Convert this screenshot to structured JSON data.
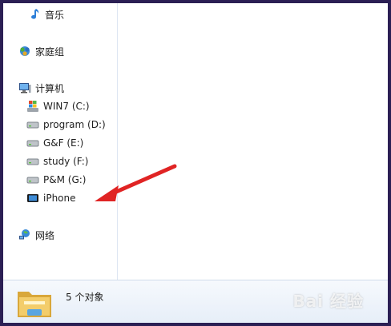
{
  "colors": {
    "frame": "#2b1f54",
    "arrow": "#e02424",
    "status_bg": "#e6eef8"
  },
  "nav": {
    "music": {
      "label": "音乐",
      "icon": "music-note-icon"
    },
    "homegroup": {
      "label": "家庭组",
      "icon": "homegroup-icon"
    },
    "computer": {
      "label": "计算机",
      "icon": "computer-icon"
    },
    "drives": [
      {
        "label": "WIN7 (C:)",
        "icon": "windows-drive-icon"
      },
      {
        "label": "program (D:)",
        "icon": "hard-drive-icon"
      },
      {
        "label": "G&F (E:)",
        "icon": "hard-drive-icon"
      },
      {
        "label": "study (F:)",
        "icon": "hard-drive-icon"
      },
      {
        "label": "P&M (G:)",
        "icon": "hard-drive-icon"
      },
      {
        "label": "iPhone",
        "icon": "iphone-device-icon"
      }
    ],
    "network": {
      "label": "网络",
      "icon": "network-icon"
    }
  },
  "status": {
    "count_text": "5 个对象",
    "icon": "folder-icon"
  },
  "watermark": "Bai 经验"
}
